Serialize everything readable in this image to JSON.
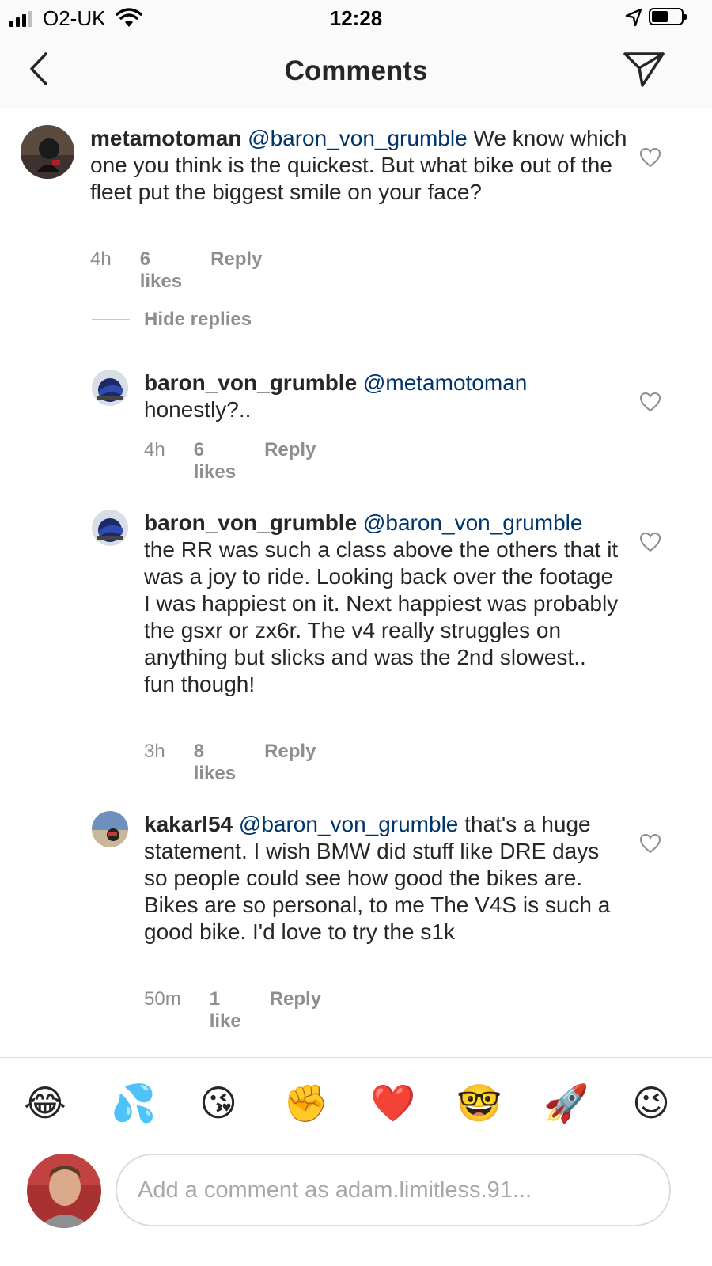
{
  "status_bar": {
    "carrier": "O2-UK",
    "time": "12:28",
    "signal_bars": 4,
    "signal_bars_filled": 3,
    "battery_level": 0.5
  },
  "nav": {
    "title": "Comments",
    "back_icon": "chevron-left-icon",
    "send_icon": "direct-send-icon"
  },
  "comments": [
    {
      "username": "metamotoman",
      "mention": "@baron_von_grumble",
      "text": " We know which one you think is the quickest.  But what bike out of the fleet put the biggest smile on your face?",
      "time": "4h",
      "likes": "6 likes",
      "reply": "Reply"
    }
  ],
  "hide_replies": "Hide replies",
  "replies": [
    {
      "username": "baron_von_grumble",
      "mention": "@metamotoman",
      "text": " honestly?..",
      "time": "4h",
      "likes": "6 likes",
      "reply": "Reply"
    },
    {
      "username": "baron_von_grumble",
      "mention": "@baron_von_grumble",
      "text": " the RR was such a class above the others that it was a joy to ride. Looking back over the footage I was happiest on it. Next happiest was probably the gsxr or zx6r. The v4 really struggles on anything but slicks and was the 2nd slowest.. fun though!",
      "time": "3h",
      "likes": "8 likes",
      "reply": "Reply"
    },
    {
      "username": "kakarl54",
      "mention": "@baron_von_grumble",
      "text": " that's a huge statement. I wish BMW did stuff like DRE days so people could see how good the bikes are. Bikes are so personal, to me The V4S is such a good bike. I'd love to try the s1k",
      "time": "50m",
      "likes": "1 like",
      "reply": "Reply"
    }
  ],
  "emoji_bar": [
    "😂",
    "💦",
    "😘",
    "✊",
    "❤️",
    "🤓",
    "🚀",
    "😉"
  ],
  "composer": {
    "placeholder": "Add a comment as adam.limitless.91..."
  },
  "colors": {
    "mention": "#003569",
    "meta_gray": "#8e8e8e",
    "text": "#262626",
    "divider": "#dbdbdb"
  }
}
